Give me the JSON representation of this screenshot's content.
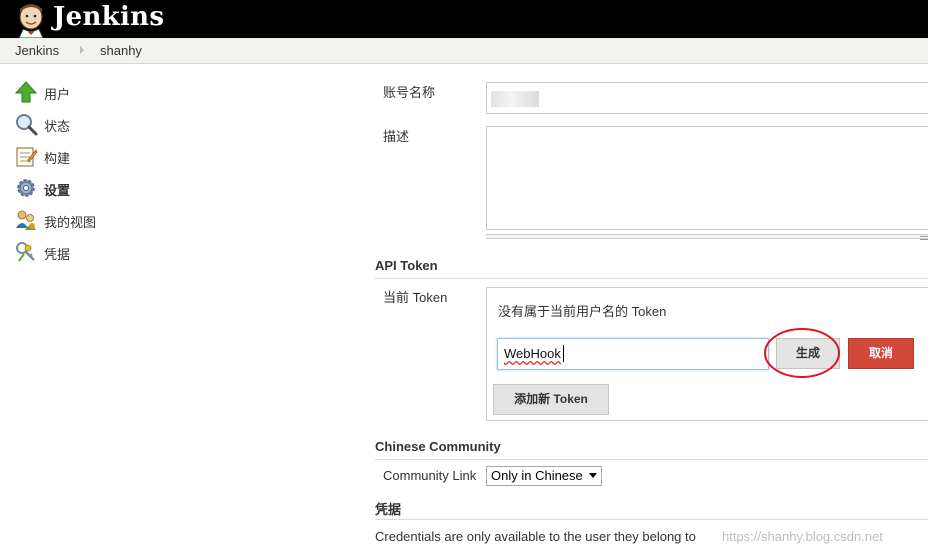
{
  "header": {
    "title": "Jenkins"
  },
  "breadcrumb": {
    "items": [
      "Jenkins",
      "shanhy"
    ]
  },
  "sidebar": {
    "items": [
      {
        "label": "用户",
        "icon": "up-arrow-icon"
      },
      {
        "label": "状态",
        "icon": "magnifier-icon"
      },
      {
        "label": "构建",
        "icon": "notepad-icon"
      },
      {
        "label": "设置",
        "icon": "gear-icon"
      },
      {
        "label": "我的视图",
        "icon": "people-icon"
      },
      {
        "label": "凭据",
        "icon": "keys-icon"
      }
    ]
  },
  "form": {
    "account_label": "账号名称",
    "description_label": "描述"
  },
  "api_token": {
    "section_title": "API Token",
    "current_label": "当前 Token",
    "none_message": "没有属于当前用户名的 Token",
    "name_input_value": "WebHook",
    "generate_label": "生成",
    "cancel_label": "取消",
    "add_label": "添加新 Token"
  },
  "community": {
    "section_title": "Chinese Community",
    "link_label": "Community Link",
    "select_value": "Only in Chinese"
  },
  "credentials": {
    "section_title": "凭据",
    "info_text": "Credentials are only available to the user they belong to"
  },
  "watermark": "https://shanhy.blog.csdn.net",
  "colors": {
    "topbar": "#000000",
    "breadcrumb_bg": "#f2f2ee",
    "cancel_button": "#d24939",
    "annotation_circle": "#e0151d",
    "input_focus": "#9ec1ea"
  }
}
